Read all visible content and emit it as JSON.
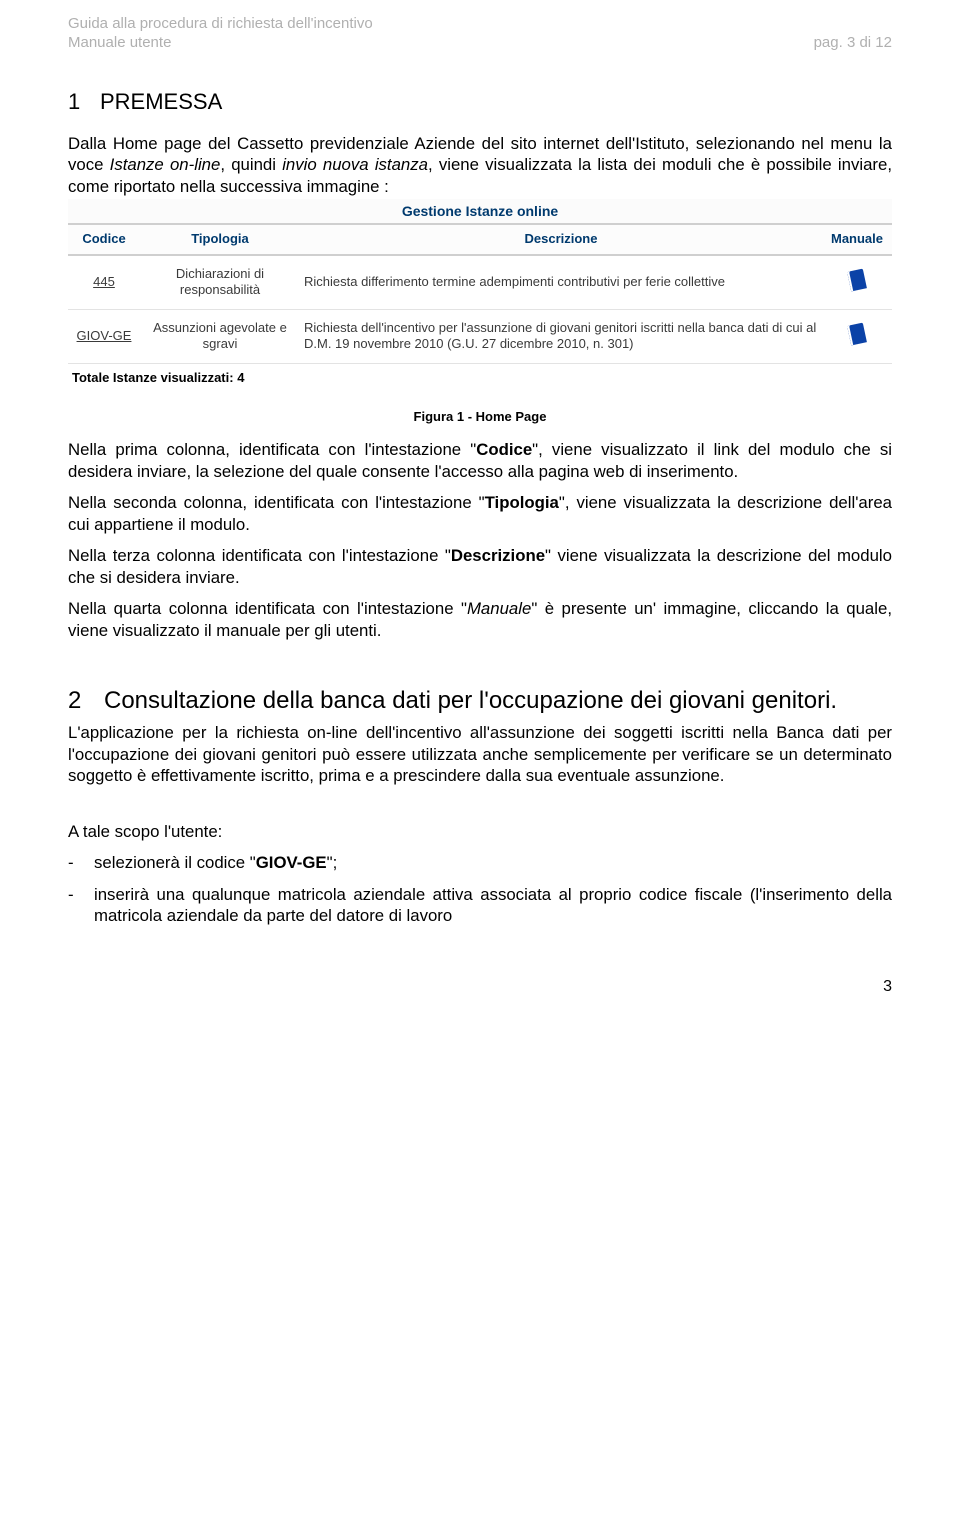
{
  "header": {
    "line1": "Guida alla procedura di richiesta dell'incentivo",
    "line2_left": "Manuale utente",
    "line2_right": "pag. 3 di 12"
  },
  "section1": {
    "num": "1",
    "title": "PREMESSA",
    "intro_a": "Dalla Home page del   Cassetto previdenziale Aziende del sito internet dell'Istituto, selezionando nel menu la voce ",
    "intro_b_italic": "Istanze on-line",
    "intro_c": ", quindi ",
    "intro_d_italic": "invio nuova istanza",
    "intro_e": ", viene visualizzata la lista dei moduli che è possibile inviare, come riportato nella successiva immagine :"
  },
  "screenshot": {
    "panel_title": "Gestione Istanze online",
    "headers": {
      "codice": "Codice",
      "tipologia": "Tipologia",
      "descrizione": "Descrizione",
      "manuale": "Manuale"
    },
    "rows": [
      {
        "codice": "445",
        "tipologia": "Dichiarazioni di responsabilità",
        "descrizione": "Richiesta differimento termine adempimenti contributivi per ferie collettive"
      },
      {
        "codice": "GIOV-GE",
        "tipologia": "Assunzioni agevolate e sgravi",
        "descrizione": "Richiesta dell'incentivo per l'assunzione di giovani genitori iscritti nella banca dati di cui al D.M. 19 novembre 2010 (G.U. 27 dicembre 2010, n. 301)"
      }
    ],
    "totale": "Totale Istanze visualizzati: 4"
  },
  "figure_caption": "Figura 1 - Home Page",
  "paras": {
    "p1a": "Nella prima colonna, identificata con l'intestazione \"",
    "p1b_bold": "Codice",
    "p1c": "\", viene visualizzato il link del modulo che si desidera inviare, la selezione del quale consente l'accesso alla pagina web di inserimento.",
    "p2a": "Nella seconda colonna, identificata con l'intestazione \"",
    "p2b_bold": "Tipologia",
    "p2c": "\", viene visualizzata la descrizione dell'area cui appartiene il modulo.",
    "p3a": "Nella terza colonna identificata con l'intestazione \"",
    "p3b_bold": "Descrizione",
    "p3c": "\" viene visualizzata la descrizione del modulo che si desidera inviare.",
    "p4a": "Nella quarta colonna identificata con l'intestazione \"",
    "p4b_italic": "Manuale",
    "p4c": "\" è presente un' immagine, cliccando la quale, viene visualizzato il manuale per gli utenti."
  },
  "section2": {
    "num": "2",
    "title": "Consultazione della banca dati per l'occupazione dei giovani genitori.",
    "para": "L'applicazione per la richiesta on-line dell'incentivo all'assunzione dei soggetti iscritti nella Banca dati per l'occupazione dei giovani genitori può essere utilizzata anche semplicemente per verificare se un determinato soggetto è effettivamente iscritto, prima e a prescindere dalla sua eventuale assunzione.",
    "subhead": "A tale scopo l'utente:",
    "bullets": {
      "b1a": "selezionerà il codice \"",
      "b1b_bold": "GIOV-GE",
      "b1c": "\";",
      "b2": "inserirà una qualunque matricola aziendale attiva associata al proprio codice fiscale (l'inserimento della matricola aziendale da parte del datore di lavoro"
    }
  },
  "page_number": "3"
}
